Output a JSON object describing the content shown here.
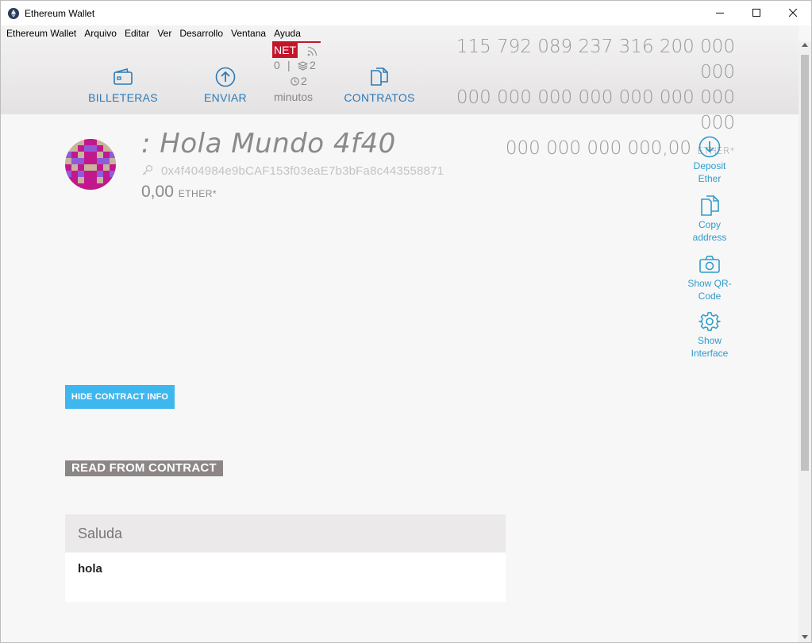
{
  "window": {
    "title": "Ethereum Wallet",
    "controls": [
      "minimize",
      "maximize",
      "close"
    ]
  },
  "menu": [
    "Ethereum Wallet",
    "Arquivo",
    "Editar",
    "Ver",
    "Desarrollo",
    "Ventana",
    "Ayuda"
  ],
  "nav": {
    "wallets": "BILLETERAS",
    "send": "ENVIAR",
    "contracts": "CONTRATOS"
  },
  "network": {
    "badge": "NET",
    "peers": "0",
    "separator": "|",
    "blocks": "2",
    "minutes_value": "2",
    "minutes_label": "minutos"
  },
  "balance": {
    "line1": "115 792 089 237 316 200 000 000",
    "line2": "000 000 000 000 000 000 000 000",
    "line3": "000 000 000 000,00",
    "unit": "ETHER*"
  },
  "contract": {
    "title": ": Hola Mundo 4f40",
    "address": "0x4f404984e9bCAF153f03eaE7b3bFa8c443558871",
    "balance": "0,00",
    "unit": "ETHER*"
  },
  "actions": {
    "deposit": [
      "Deposit",
      "Ether"
    ],
    "copy": [
      "Copy",
      "address"
    ],
    "qr": [
      "Show QR-",
      "Code"
    ],
    "interface": [
      "Show",
      "Interface"
    ]
  },
  "hide_button": "HIDE CONTRACT INFO",
  "read_section": "READ FROM CONTRACT",
  "method": {
    "name": "Saluda",
    "value": "hola"
  },
  "colors": {
    "accent": "#2b7ab8",
    "action": "#2f9bcb",
    "button": "#3eb7ef",
    "net_badge": "#c4162b"
  }
}
